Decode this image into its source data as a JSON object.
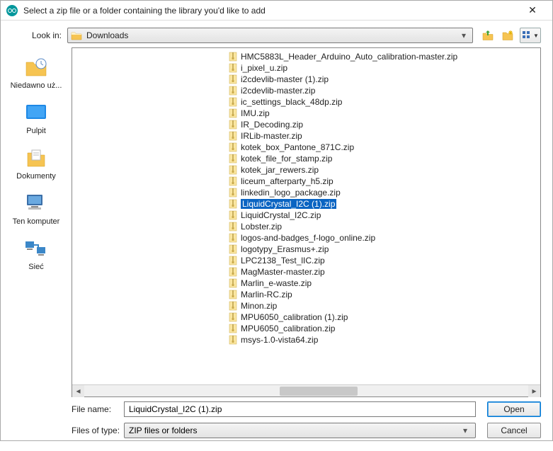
{
  "title": "Select a zip file or a folder containing the library you'd like to add",
  "look_in_label": "Look in:",
  "look_in_value": "Downloads",
  "sidebar": {
    "items": [
      {
        "label": "Niedawno uż..."
      },
      {
        "label": "Pulpit"
      },
      {
        "label": "Dokumenty"
      },
      {
        "label": "Ten komputer"
      },
      {
        "label": "Sieć"
      }
    ]
  },
  "files": [
    "HMC5883L_Header_Arduino_Auto_calibration-master.zip",
    "i_pixel_u.zip",
    "i2cdevlib-master (1).zip",
    "i2cdevlib-master.zip",
    "ic_settings_black_48dp.zip",
    "IMU.zip",
    "IR_Decoding.zip",
    "IRLib-master.zip",
    "kotek_box_Pantone_871C.zip",
    "kotek_file_for_stamp.zip",
    "kotek_jar_rewers.zip",
    "liceum_afterparty_h5.zip",
    "linkedin_logo_package.zip",
    "LiquidCrystal_I2C (1).zip",
    "LiquidCrystal_I2C.zip",
    "Lobster.zip",
    "logos-and-badges_f-logo_online.zip",
    "logotypy_Erasmus+.zip",
    "LPC2138_Test_lIC.zip",
    "MagMaster-master.zip",
    "Marlin_e-waste.zip",
    "Marlin-RC.zip",
    "Minon.zip",
    "MPU6050_calibration (1).zip",
    "MPU6050_calibration.zip",
    "msys-1.0-vista64.zip"
  ],
  "selected_index": 13,
  "file_name_label": "File name:",
  "file_name_value": "LiquidCrystal_I2C (1).zip",
  "file_type_label": "Files of type:",
  "file_type_value": "ZIP files or folders",
  "open_label": "Open",
  "cancel_label": "Cancel"
}
